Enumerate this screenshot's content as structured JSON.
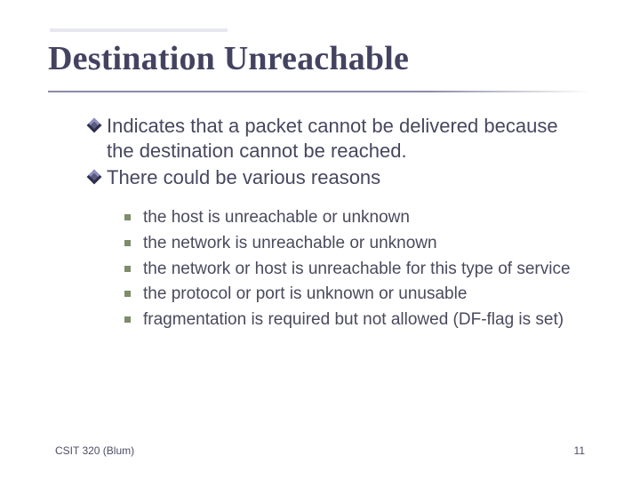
{
  "title": "Destination Unreachable",
  "body": {
    "point1": "Indicates that a packet cannot be delivered because the destination cannot be reached.",
    "point2": "There could be various reasons",
    "sub": [
      "the host is unreachable or unknown",
      "the network is unreachable or unknown",
      "the network or host is unreachable for this type of service",
      "the protocol or port is unknown or unusable",
      "fragmentation is required but not allowed (DF-flag is set)"
    ]
  },
  "footer": {
    "left": "CSIT 320 (Blum)",
    "right": "11"
  }
}
